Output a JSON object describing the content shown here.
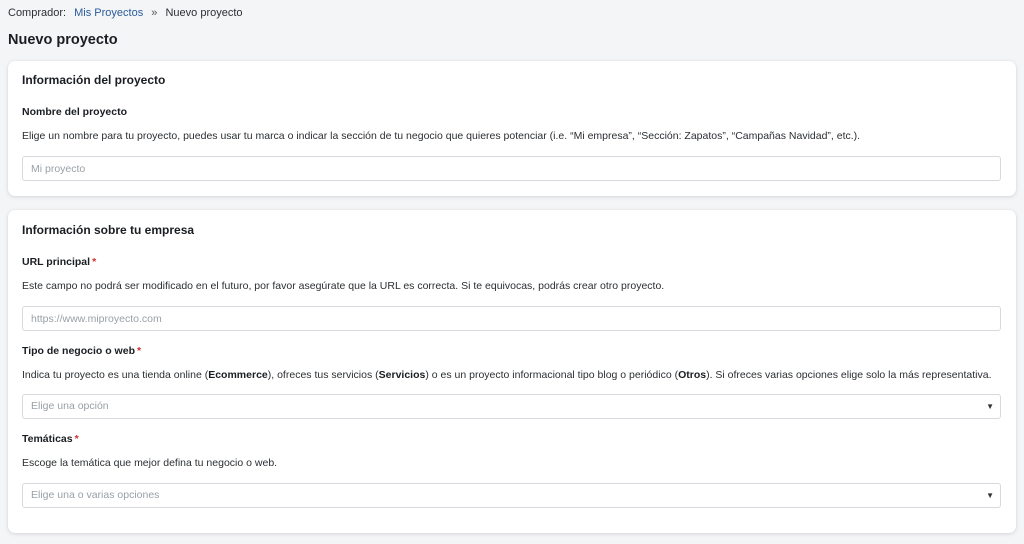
{
  "breadcrumb": {
    "prefix": "Comprador:",
    "link": "Mis Proyectos",
    "separator": "»",
    "current": "Nuevo proyecto"
  },
  "page_title": "Nuevo proyecto",
  "project_card": {
    "title": "Información del proyecto",
    "name_label": "Nombre del proyecto",
    "name_help": "Elige un nombre para tu proyecto, puedes usar tu marca o indicar la sección de tu negocio que quieres potenciar (i.e. “Mi empresa”, “Sección: Zapatos”, “Campañas Navidad”, etc.).",
    "name_placeholder": "Mi proyecto",
    "name_value": ""
  },
  "company_card": {
    "title": "Información sobre tu empresa",
    "url_label": "URL principal",
    "url_help": "Este campo no podrá ser modificado en el futuro, por favor asegúrate que la URL es correcta. Si te equivocas, podrás crear otro proyecto.",
    "url_placeholder": "https://www.miproyecto.com",
    "url_value": "",
    "type_label": "Tipo de negocio o web",
    "type_help": {
      "part1": "Indica tu proyecto es una tienda online (",
      "bold1": "Ecommerce",
      "part2": "), ofreces tus servicios (",
      "bold2": "Servicios",
      "part3": ") o es un proyecto informacional tipo blog o periódico (",
      "bold3": "Otros",
      "part4": "). Si ofreces varias opciones elige solo la más representativa."
    },
    "type_placeholder": "Elige una opción",
    "topics_label": "Temáticas",
    "topics_help": "Escoge la temática que mejor defina tu negocio o web.",
    "topics_placeholder": "Elige una o varias opciones"
  },
  "required_mark": "*",
  "colors": {
    "background": "#f4f5f7",
    "link": "#2a5c9a",
    "required": "#d0312d",
    "border": "#d6d9dd"
  },
  "icons": {
    "dropdown_caret": "caret-down-icon"
  }
}
